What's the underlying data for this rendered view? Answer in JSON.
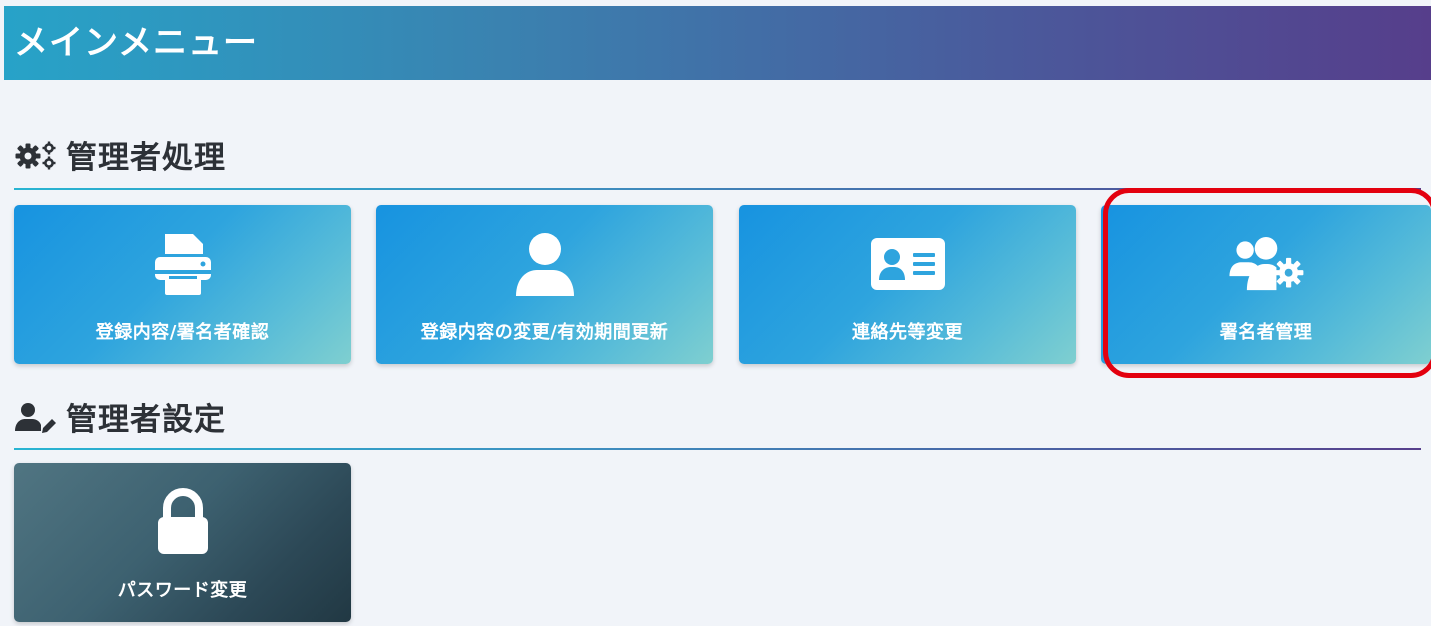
{
  "header": {
    "title": "メインメニュー"
  },
  "sections": [
    {
      "title": "管理者処理",
      "icon": "gears-icon",
      "cards": [
        {
          "label": "登録内容/署名者確認",
          "icon": "printer-icon"
        },
        {
          "label": "登録内容の変更/有効期間更新",
          "icon": "user-icon"
        },
        {
          "label": "連絡先等変更",
          "icon": "id-card-icon"
        },
        {
          "label": "署名者管理",
          "icon": "users-gear-icon"
        }
      ]
    },
    {
      "title": "管理者設定",
      "icon": "user-pen-icon",
      "cards": [
        {
          "label": "パスワード変更",
          "icon": "lock-icon"
        }
      ]
    }
  ],
  "highlight": {
    "target": "署名者管理",
    "color": "#e3000f"
  },
  "colors": {
    "header_start": "#27a3c8",
    "header_end": "#563e8b",
    "card_blue_start": "#1793e0",
    "card_blue_end": "#7fcfd0",
    "card_dark_start": "#507582",
    "card_dark_end": "#213843",
    "background": "#f1f4f9"
  }
}
